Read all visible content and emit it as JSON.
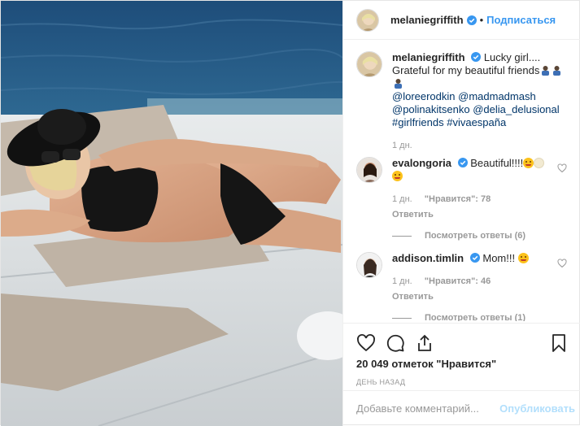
{
  "post": {
    "author": "melaniegriffith",
    "follow_label": "Подписаться",
    "caption": {
      "text_part1": "Lucky girl.... Grateful for my beautiful friends",
      "mention1": "@loreerodkin",
      "mention2": "@madmadmash",
      "mention3": "@polinakitsenko",
      "mention4": "@delia_delusional",
      "tag1": "#girlfriends",
      "tag2": "#vivaespaña",
      "time": "1 дн."
    },
    "comments": [
      {
        "user": "evalongoria",
        "text": "Beautiful!!!!",
        "time": "1 дн.",
        "likes": "\"Нравится\": 78",
        "reply": "Ответить",
        "view_replies": "Посмотреть ответы (6)"
      },
      {
        "user": "addison.timlin",
        "text": "Mom!!!",
        "time": "1 дн.",
        "likes": "\"Нравится\": 46",
        "reply": "Ответить",
        "view_replies": "Посмотреть ответы (1)"
      }
    ],
    "likes_count": "20 049 отметок \"Нравится\"",
    "posted_ago": "день назад",
    "add_comment_placeholder": "Добавьте комментарий...",
    "publish_label": "Опубликовать"
  },
  "icons": [
    "heart-icon",
    "comment-icon",
    "share-icon",
    "bookmark-icon",
    "verified-badge-icon",
    "small-heart-icon"
  ],
  "colors": {
    "link_blue": "#3897f0",
    "mention_navy": "#003569",
    "muted_gray": "#999999",
    "verified_blue": "#3897f0"
  }
}
